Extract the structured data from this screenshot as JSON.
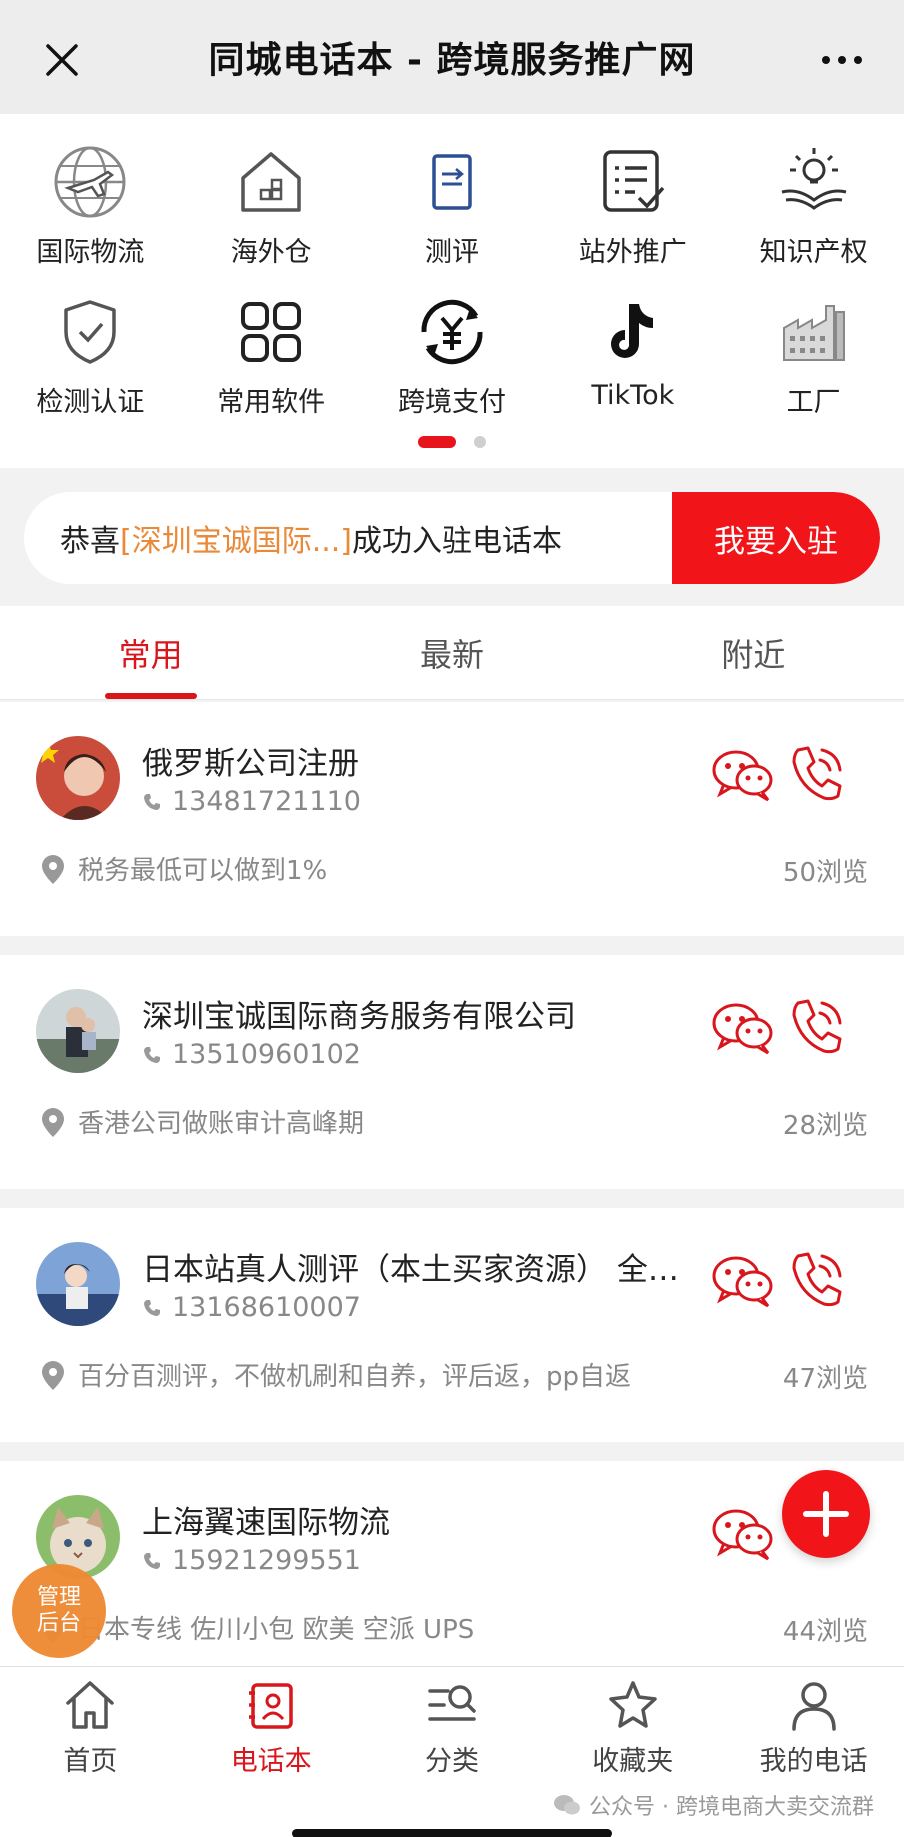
{
  "header": {
    "title": "同城电话本 - 跨境服务推广网"
  },
  "grid": [
    {
      "label": "国际物流",
      "icon": "globe-plane-icon"
    },
    {
      "label": "海外仓",
      "icon": "warehouse-house-icon"
    },
    {
      "label": "测评",
      "icon": "document-review-icon"
    },
    {
      "label": "站外推广",
      "icon": "checklist-icon"
    },
    {
      "label": "知识产权",
      "icon": "lightbulb-book-icon"
    },
    {
      "label": "检测认证",
      "icon": "shield-check-icon"
    },
    {
      "label": "常用软件",
      "icon": "app-grid-icon"
    },
    {
      "label": "跨境支付",
      "icon": "yen-exchange-icon"
    },
    {
      "label": "TikTok",
      "icon": "tiktok-icon"
    },
    {
      "label": "工厂",
      "icon": "factory-icon"
    }
  ],
  "notice": {
    "prefix": "恭喜",
    "highlight": "[深圳宝诚国际...]",
    "suffix": "成功入驻电话本",
    "button": "我要入驻"
  },
  "tabs": [
    "常用",
    "最新",
    "附近"
  ],
  "listings": [
    {
      "name": "俄罗斯公司注册",
      "phone": "13481721110",
      "desc": "税务最低可以做到1%",
      "views": "50浏览"
    },
    {
      "name": "深圳宝诚国际商务服务有限公司",
      "phone": "13510960102",
      "desc": "香港公司做账审计高峰期",
      "views": "28浏览"
    },
    {
      "name": "日本站真人测评（本土买家资源） 全…",
      "phone": "13168610007",
      "desc": "百分百测评，不做机刷和自养，评后返，pp自返",
      "views": "47浏览"
    },
    {
      "name": "上海翼速国际物流",
      "phone": "15921299551",
      "desc": "日本专线 佐川小包 欧美 空派 UPS",
      "views": "44浏览"
    }
  ],
  "admin_label": "管理后台",
  "bottom_nav": [
    {
      "label": "首页",
      "icon": "home-icon"
    },
    {
      "label": "电话本",
      "icon": "phonebook-icon"
    },
    {
      "label": "分类",
      "icon": "category-search-icon"
    },
    {
      "label": "收藏夹",
      "icon": "star-icon"
    },
    {
      "label": "我的电话",
      "icon": "user-icon"
    }
  ],
  "watermark": "公众号 · 跨境电商大卖交流群",
  "colors": {
    "accent": "#d8161c",
    "button_red": "#f11419",
    "highlight_orange": "#e98a3a",
    "admin_orange": "#ef8a33"
  }
}
